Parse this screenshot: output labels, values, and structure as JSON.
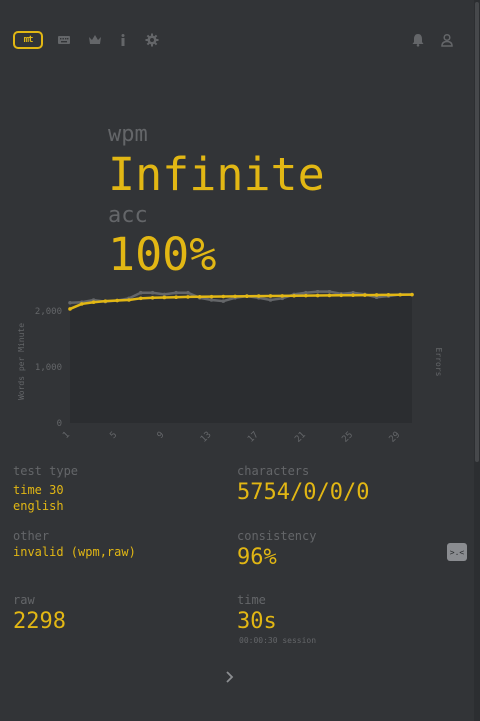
{
  "nav": {
    "logo_text": "mt",
    "icons": [
      "keyboard-icon",
      "crown-icon",
      "info-icon",
      "gear-icon",
      "bell-icon",
      "user-icon"
    ]
  },
  "result": {
    "wpm_label": "wpm",
    "wpm_value": "Infinite",
    "acc_label": "acc",
    "acc_value": "100%"
  },
  "chart_data": {
    "type": "line",
    "ylabel": "Words per Minute",
    "y2label": "Errors",
    "y_ticks": [
      "0",
      "1,000",
      "2,000"
    ],
    "ylim": [
      0,
      2200
    ],
    "x_ticks": [
      "1",
      "5",
      "9",
      "13",
      "17",
      "21",
      "25",
      "29"
    ],
    "x": [
      1,
      2,
      3,
      4,
      5,
      6,
      7,
      8,
      9,
      10,
      11,
      12,
      13,
      14,
      15,
      16,
      17,
      18,
      19,
      20,
      21,
      22,
      23,
      24,
      25,
      26,
      27,
      28,
      29,
      30
    ],
    "series": [
      {
        "color": "#e2b714",
        "values": [
          2040,
          2130,
          2160,
          2180,
          2190,
          2200,
          2230,
          2240,
          2245,
          2250,
          2255,
          2258,
          2260,
          2262,
          2265,
          2268,
          2270,
          2272,
          2274,
          2276,
          2278,
          2280,
          2282,
          2284,
          2286,
          2288,
          2290,
          2292,
          2294,
          2296
        ]
      },
      {
        "color": "#646669",
        "values": [
          2150,
          2160,
          2200,
          2170,
          2190,
          2230,
          2330,
          2330,
          2300,
          2330,
          2330,
          2240,
          2200,
          2180,
          2240,
          2270,
          2240,
          2200,
          2230,
          2300,
          2330,
          2350,
          2350,
          2310,
          2330,
          2300,
          2250,
          2270,
          2300,
          2300
        ]
      }
    ],
    "grid": false,
    "legend": "none"
  },
  "stats": {
    "test_type_label": "test type",
    "test_type_line1": "time 30",
    "test_type_line2": "english",
    "other_label": "other",
    "other_value": "invalid (wpm,raw)",
    "raw_label": "raw",
    "raw_value": "2298",
    "characters_label": "characters",
    "characters_value": "5754/0/0/0",
    "consistency_label": "consistency",
    "consistency_value": "96%",
    "time_label": "time",
    "time_value": "30s",
    "session_text": "00:00:30 session"
  },
  "report_icon_text": ">.<",
  "next_icon": "chevron-right-icon",
  "colors": {
    "background": "#323437",
    "main": "#e2b714",
    "sub": "#646669"
  }
}
